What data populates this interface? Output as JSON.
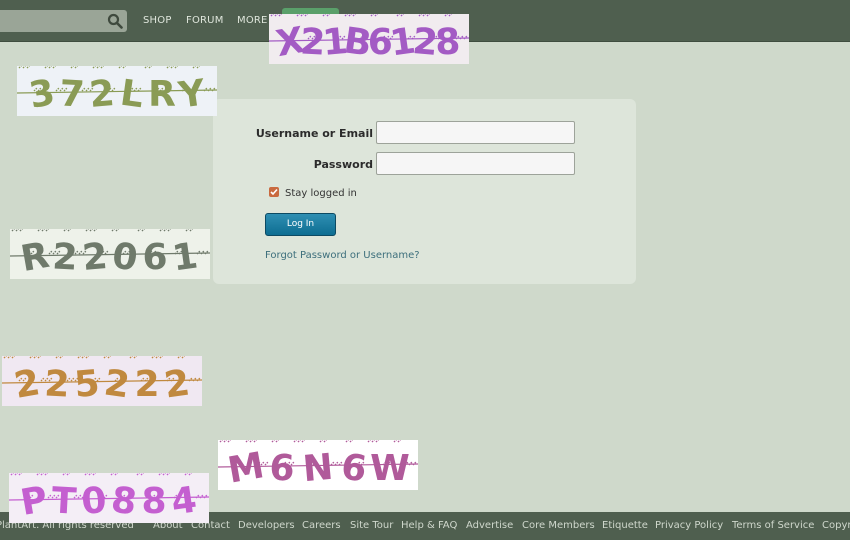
{
  "nav": {
    "links": [
      "SHOP",
      "FORUM",
      "MORE"
    ],
    "search_icon": "magnifier-icon"
  },
  "login": {
    "username_label": "Username or Email",
    "password_label": "Password",
    "username_value": "",
    "password_value": "",
    "stay_logged_in": "Stay logged in",
    "stay_checked": true,
    "login_button": "Log In",
    "forgot_link": "Forgot Password or Username?"
  },
  "captchas": [
    {
      "text": "X21B6128",
      "color": "#a35bc4",
      "bg": "#f1ecef"
    },
    {
      "text": "372LRY",
      "color": "#8a9b55",
      "bg": "#eef2f7"
    },
    {
      "text": "R22061",
      "color": "#6f7a6b",
      "bg": "#eef2ea"
    },
    {
      "text": "225222",
      "color": "#c0893f",
      "bg": "#f0e8f2"
    },
    {
      "text": "M6N6W",
      "color": "#b05a9a",
      "bg": "#ffffff"
    },
    {
      "text": "PT0884",
      "color": "#c45fd0",
      "bg": "#f4eef6"
    }
  ],
  "footer": {
    "copyright": "PlantArt. All rights reserved",
    "links": [
      "About",
      "Contact",
      "Developers",
      "Careers",
      "Site Tour",
      "Help & FAQ",
      "Advertise",
      "Core Members",
      "Etiquette",
      "Privacy Policy",
      "Terms of Service",
      "Copyright"
    ]
  },
  "colors": {
    "nav_bg": "#4f5f4f",
    "page_bg": "#cfd9cb",
    "panel_bg": "#dde5da",
    "button": "#0d6d91",
    "link": "#3d6f7c"
  }
}
